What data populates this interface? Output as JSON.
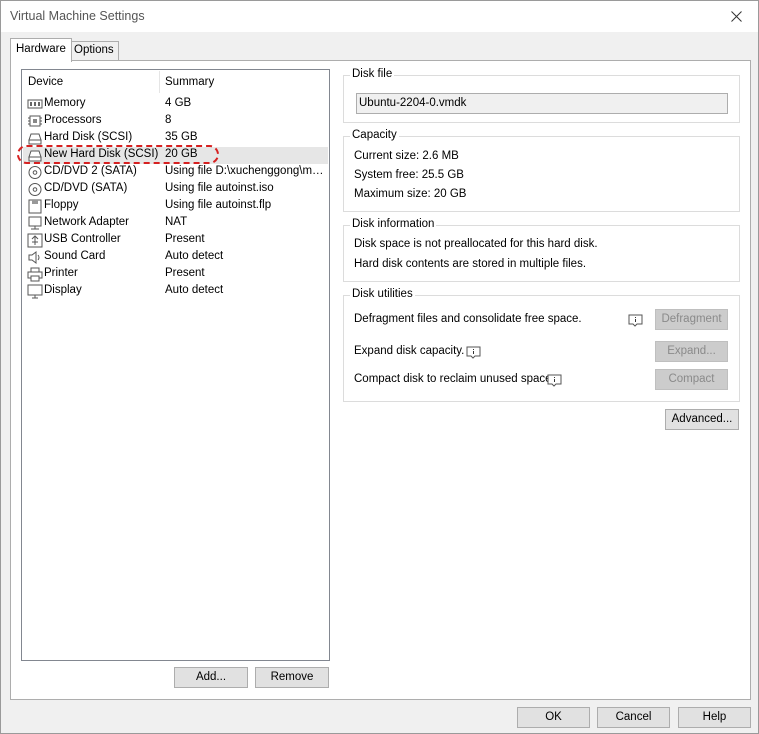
{
  "window": {
    "title": "Virtual Machine Settings"
  },
  "tabs": [
    {
      "label": "Hardware",
      "active": true
    },
    {
      "label": "Options",
      "active": false
    }
  ],
  "device_list": {
    "headers": {
      "device": "Device",
      "summary": "Summary"
    },
    "rows": [
      {
        "icon": "memory-icon",
        "device": "Memory",
        "summary": "4 GB"
      },
      {
        "icon": "processor-icon",
        "device": "Processors",
        "summary": "8"
      },
      {
        "icon": "hard-disk-icon",
        "device": "Hard Disk (SCSI)",
        "summary": "35 GB"
      },
      {
        "icon": "hard-disk-icon",
        "device": "New Hard Disk (SCSI)",
        "summary": "20 GB",
        "selected": true
      },
      {
        "icon": "cd-dvd-icon",
        "device": "CD/DVD 2 (SATA)",
        "summary": "Using file D:\\xuchenggong\\ma..."
      },
      {
        "icon": "cd-dvd-icon",
        "device": "CD/DVD (SATA)",
        "summary": "Using file autoinst.iso"
      },
      {
        "icon": "floppy-icon",
        "device": "Floppy",
        "summary": "Using file autoinst.flp"
      },
      {
        "icon": "network-adapter-icon",
        "device": "Network Adapter",
        "summary": "NAT"
      },
      {
        "icon": "usb-icon",
        "device": "USB Controller",
        "summary": "Present"
      },
      {
        "icon": "sound-card-icon",
        "device": "Sound Card",
        "summary": "Auto detect"
      },
      {
        "icon": "printer-icon",
        "device": "Printer",
        "summary": "Present"
      },
      {
        "icon": "display-icon",
        "device": "Display",
        "summary": "Auto detect"
      }
    ],
    "add_label": "Add...",
    "remove_label": "Remove"
  },
  "disk_file": {
    "label": "Disk file",
    "value": "Ubuntu-2204-0.vmdk"
  },
  "capacity": {
    "label": "Capacity",
    "current": "Current size:  2.6 MB",
    "free": "System free:  25.5 GB",
    "maximum": "Maximum size:  20 GB"
  },
  "disk_information": {
    "label": "Disk information",
    "line1": "Disk space is not preallocated for this hard disk.",
    "line2": "Hard disk contents are stored in multiple files."
  },
  "disk_utilities": {
    "label": "Disk utilities",
    "defrag_text": "Defragment files and consolidate free space.",
    "defrag_button": "Defragment",
    "expand_text": "Expand disk capacity.",
    "expand_button": "Expand...",
    "compact_text": "Compact disk to reclaim unused space.",
    "compact_button": "Compact"
  },
  "advanced_button": "Advanced...",
  "footer": {
    "ok": "OK",
    "cancel": "Cancel",
    "help": "Help"
  }
}
